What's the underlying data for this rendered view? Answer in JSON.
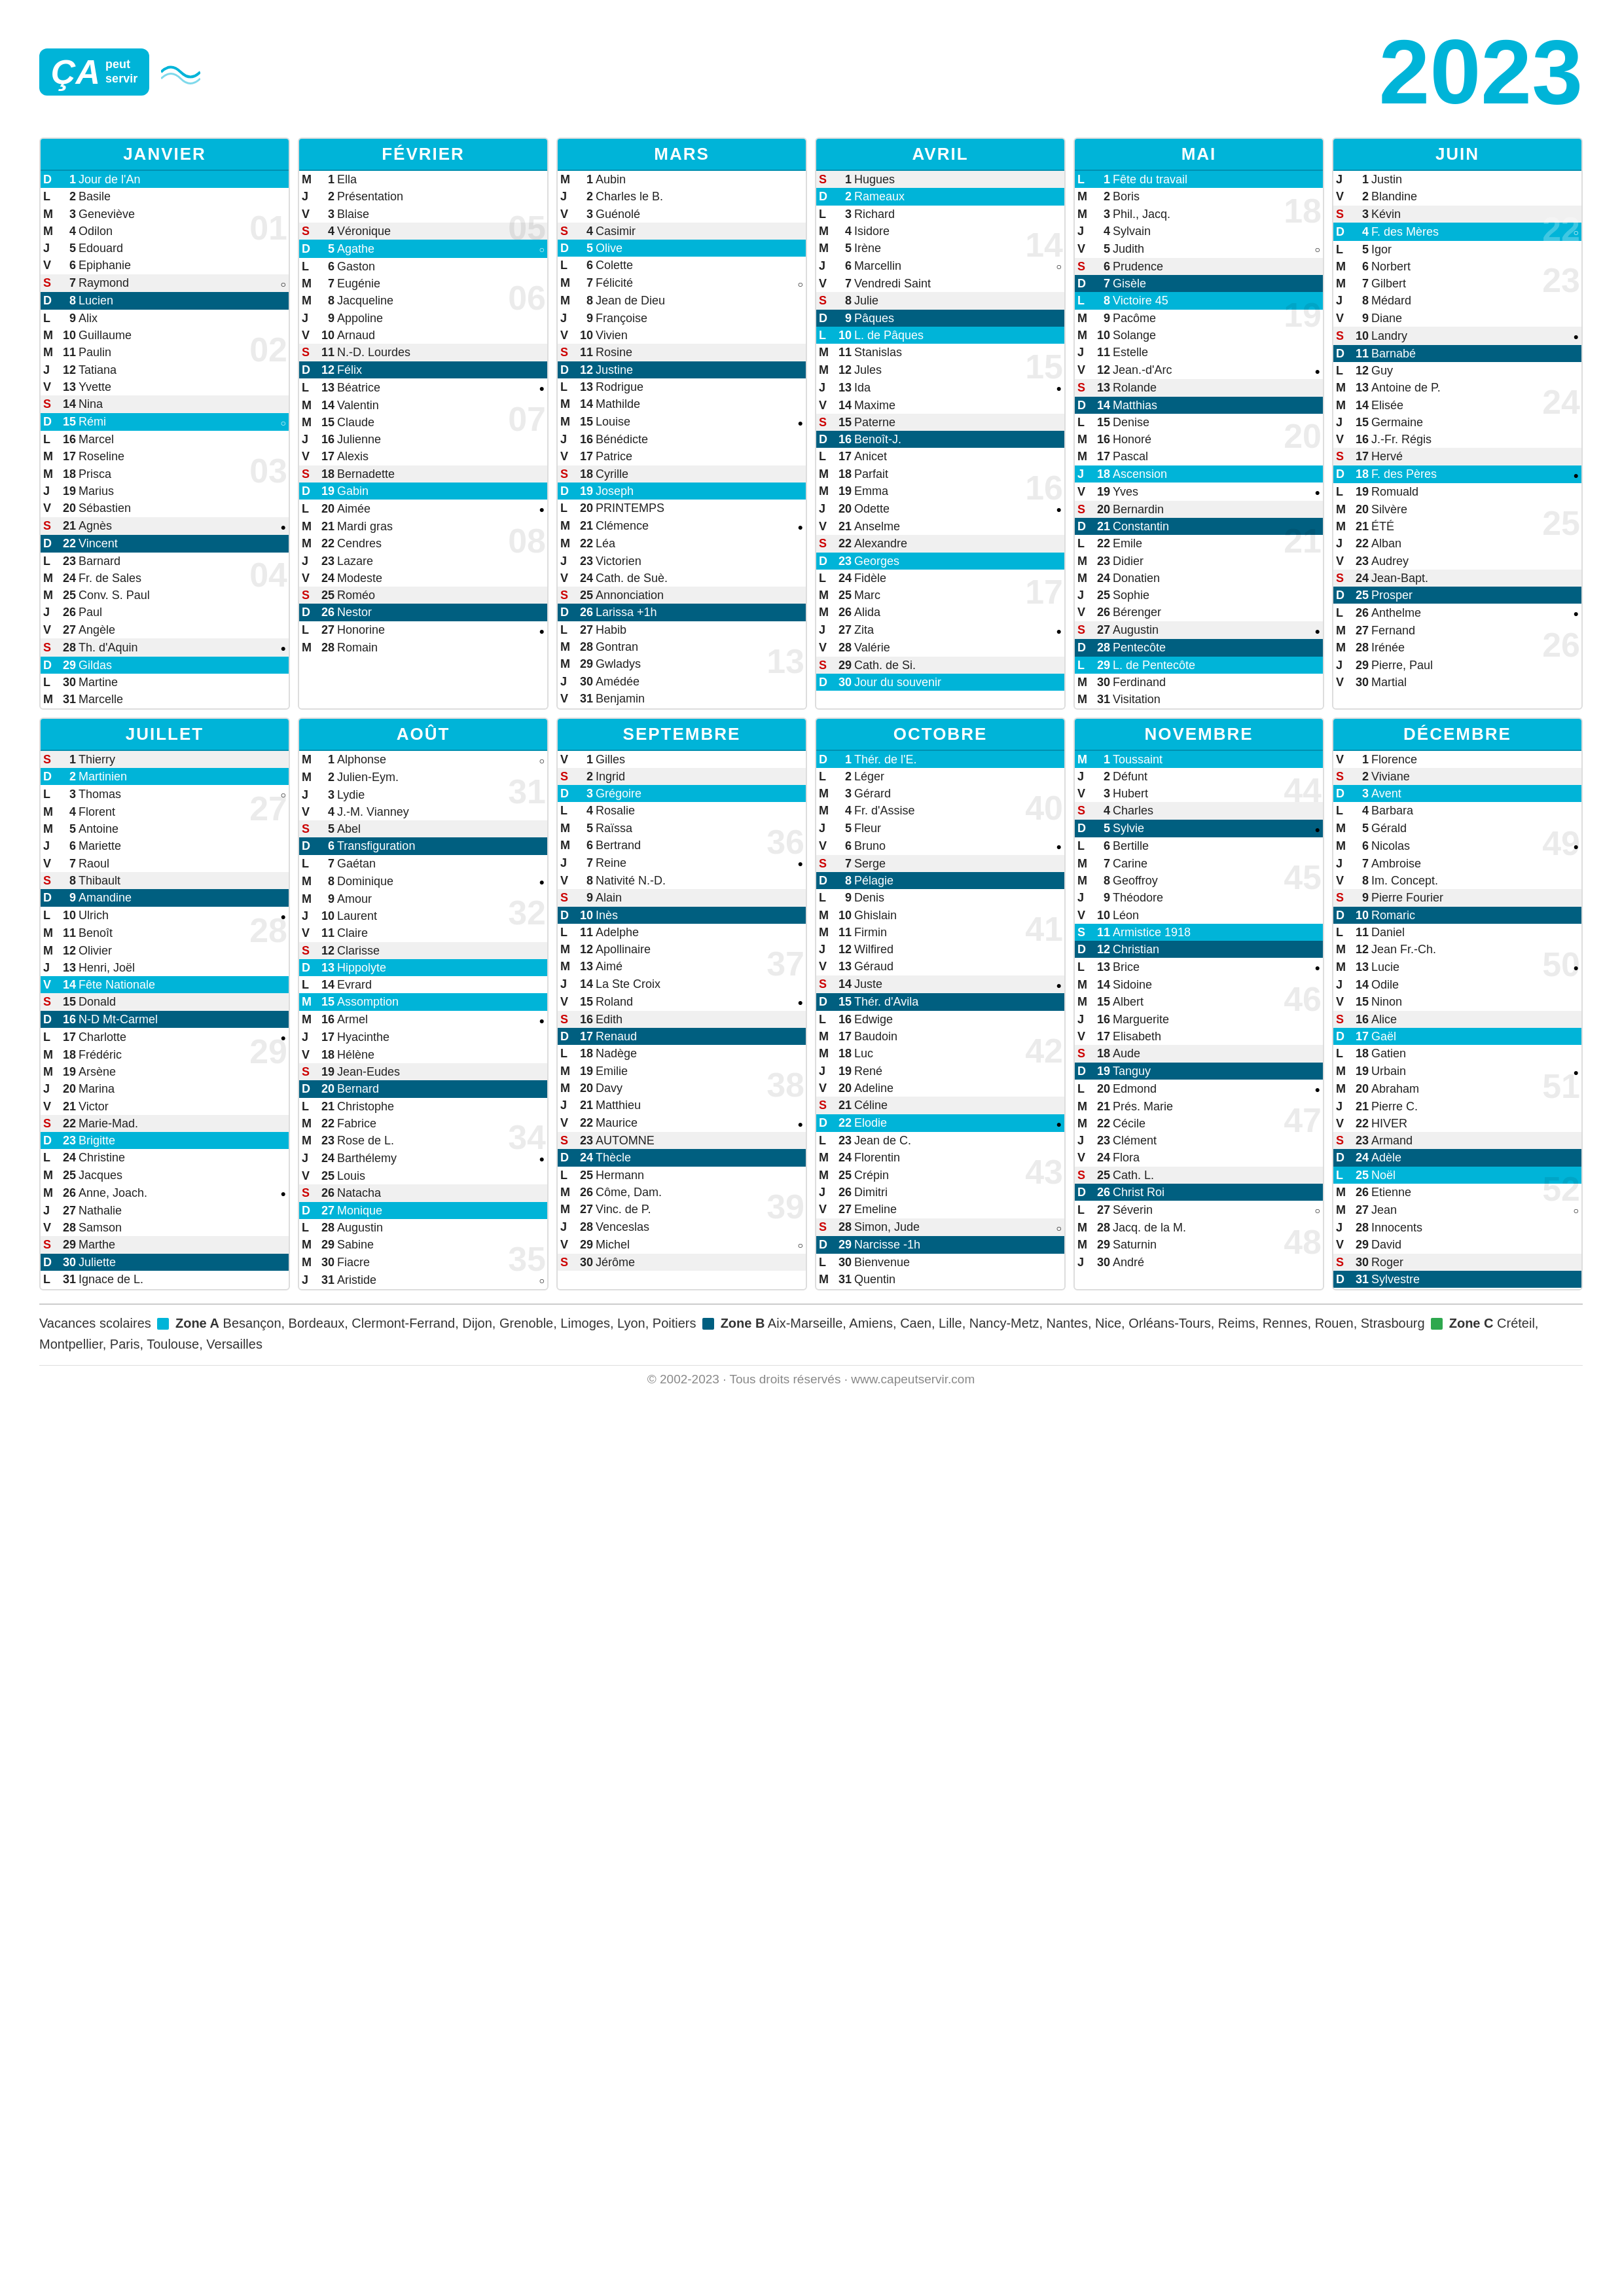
{
  "header": {
    "logo_text": "ÇA",
    "logo_sub": "peut\nservir",
    "year": "2023",
    "website": "www.capeutservir.com"
  },
  "footer": {
    "copyright": "© 2002-2023 · Tous droits réservés · www.capeutservir.com"
  },
  "legend": {
    "text": "Vacances scolaires",
    "zone_a_label": "Zone A",
    "zone_a_cities": "Besançon, Bordeaux, Clermont-Ferrand, Dijon, Grenoble, Limoges, Lyon, Poitiers",
    "zone_b_label": "Zone B",
    "zone_b_cities": "Aix-Marseille, Amiens, Caen, Lille, Nancy-Metz, Nantes, Nice, Orléans-Tours, Reims, Rennes, Rouen, Strasbourg",
    "zone_c_label": "Zone C",
    "zone_c_cities": "Créteil, Montpellier, Paris, Toulouse, Versailles"
  },
  "months": [
    {
      "name": "JANVIER"
    },
    {
      "name": "FÉVRIER"
    },
    {
      "name": "MARS"
    },
    {
      "name": "AVRIL"
    },
    {
      "name": "MAI"
    },
    {
      "name": "JUIN"
    },
    {
      "name": "JUILLET"
    },
    {
      "name": "AOÛT"
    },
    {
      "name": "SEPTEMBRE"
    },
    {
      "name": "OCTOBRE"
    },
    {
      "name": "NOVEMBRE"
    },
    {
      "name": "DÉCEMBRE"
    }
  ]
}
